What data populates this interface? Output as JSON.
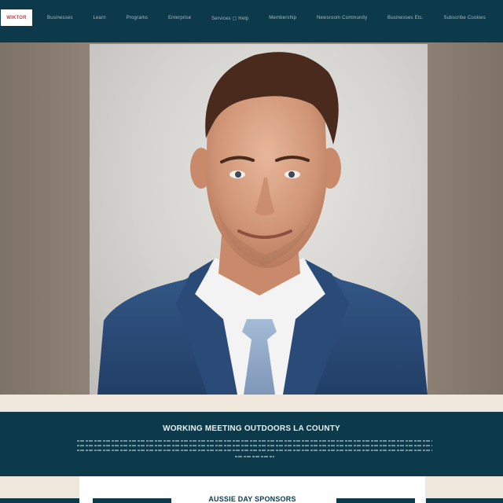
{
  "header": {
    "logo_text": "WIKTOR",
    "nav_items": [
      "Businesses",
      "Learn",
      "Programs",
      "Enterprise",
      "Services ▢ Help",
      "Membership",
      "Newsroom Community",
      "Businesses Etc.",
      "Subscribe Cookies"
    ]
  },
  "hero": {
    "portrait_alt": "Portrait of a man in a navy suit with a light blue tie"
  },
  "band": {
    "title": "WORKING MEETING OUTDOORS LA COUNTY"
  },
  "bottom": {
    "heading": "AUSSIE DAY SPONSORS"
  },
  "colors": {
    "primary": "#0c3a4a",
    "background": "#efe7dc",
    "accent": "#b8433a",
    "suit": "#2f517c",
    "tie": "#8ea7c6"
  }
}
